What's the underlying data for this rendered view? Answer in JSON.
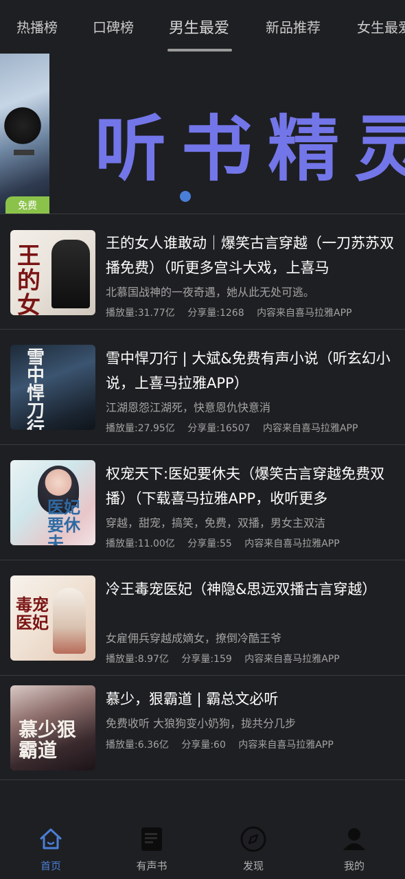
{
  "tabs": [
    {
      "label": "热播榜"
    },
    {
      "label": "口碑榜"
    },
    {
      "label": "男生最爱",
      "active": true
    },
    {
      "label": "新品推荐"
    },
    {
      "label": "女生最爱"
    }
  ],
  "banner": {
    "title": "听书精灵",
    "badge": "免费"
  },
  "items": [
    {
      "title": "王的女人谁敢动｜爆笑古言穿越（一刀苏苏双播免费）（听更多宫斗大戏，上喜马",
      "desc": "北慕国战神的一夜奇遇，她从此无处可逃。",
      "plays": "播放量:31.77亿",
      "shares": "分享量:1268",
      "source": "内容来自喜马拉雅APP",
      "cover_text": "王的女人"
    },
    {
      "title": "雪中悍刀行 | 大斌&免费有声小说（听玄幻小说，上喜马拉雅APP）",
      "desc": "江湖恩怨江湖死，快意恩仇快意消",
      "plays": "播放量:27.95亿",
      "shares": "分享量:16507",
      "source": "内容来自喜马拉雅APP",
      "cover_text": "雪中悍刀行"
    },
    {
      "title": "权宠天下:医妃要休夫（爆笑古言穿越免费双播）（下载喜马拉雅APP，收听更多",
      "desc": "穿越，甜宠，搞笑，免费，双播，男女主双洁",
      "plays": "播放量:11.00亿",
      "shares": "分享量:55",
      "source": "内容来自喜马拉雅APP",
      "cover_text": "医妃要休夫"
    },
    {
      "title": "冷王毒宠医妃（神隐&思远双播古言穿越）",
      "desc": "女雇佣兵穿越成嫡女，撩倒冷酷王爷",
      "plays": "播放量:8.97亿",
      "shares": "分享量:159",
      "source": "内容来自喜马拉雅APP",
      "cover_text": "毒宠医妃"
    },
    {
      "title": "慕少，狠霸道 | 霸总文必听",
      "desc": "免费收听 大狼狗变小奶狗，拢共分几步",
      "plays": "播放量:6.36亿",
      "shares": "分享量:60",
      "source": "内容来自喜马拉雅APP",
      "cover_text": "慕少狠霸道"
    }
  ],
  "nav": [
    {
      "label": "首页",
      "icon": "home-icon",
      "active": true
    },
    {
      "label": "有声书",
      "icon": "audiobook-icon"
    },
    {
      "label": "发现",
      "icon": "compass-icon"
    },
    {
      "label": "我的",
      "icon": "profile-icon"
    }
  ],
  "colors": {
    "background": "#1e1f22",
    "accent": "#4a7fd8",
    "banner_title": "#7376e8",
    "badge": "#8bc34a"
  }
}
